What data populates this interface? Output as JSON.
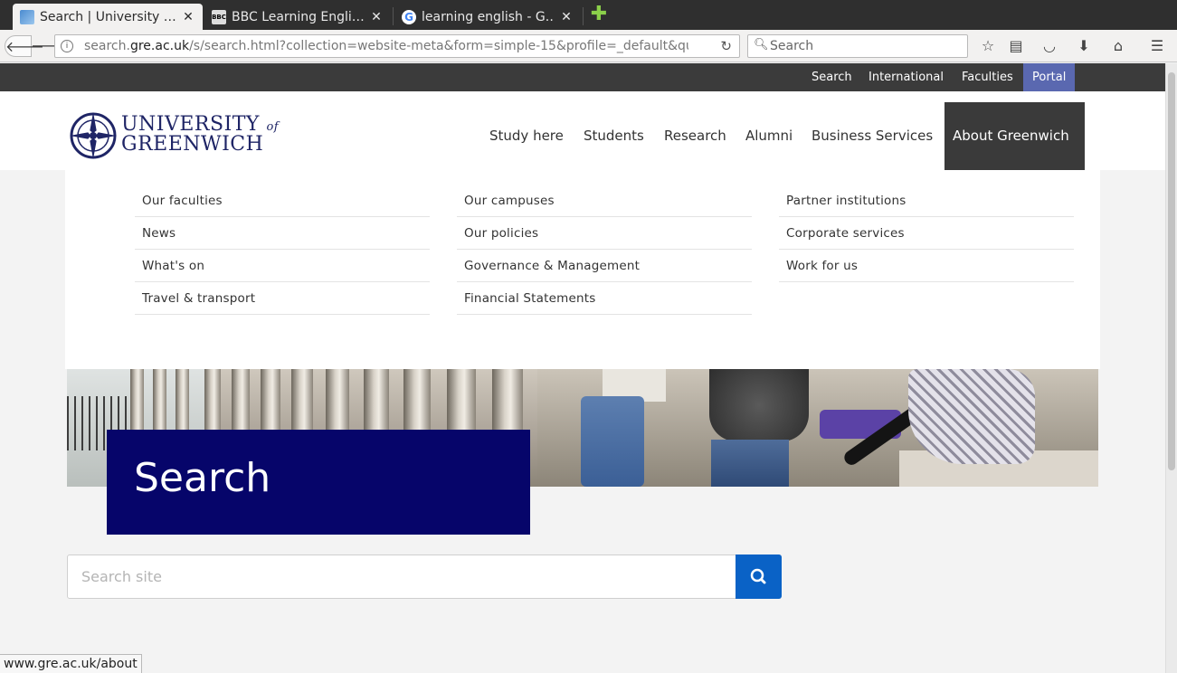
{
  "browser": {
    "tabs": [
      {
        "title": "Search | University …",
        "active": true
      },
      {
        "title": "BBC Learning Engli…",
        "active": false
      },
      {
        "title": "learning english - G…",
        "active": false
      }
    ],
    "url_prefix": "search.",
    "url_domain": "gre.ac.uk",
    "url_rest": "/s/search.html?collection=website-meta&form=simple-15&profile=_default&query",
    "search_placeholder": "Search",
    "status_url": "www.gre.ac.uk/about"
  },
  "utility_nav": {
    "items": [
      "Search",
      "International",
      "Faculties",
      "Portal"
    ]
  },
  "logo": {
    "line1": "UNIVERSITY",
    "of": "of",
    "line2": "GREENWICH",
    "color": "#1f2566"
  },
  "main_nav": {
    "items": [
      "Study here",
      "Students",
      "Research",
      "Alumni",
      "Business Services",
      "About Greenwich"
    ],
    "active": "About Greenwich"
  },
  "mega_menu": {
    "col1": [
      "Our faculties",
      "News",
      "What's on",
      "Travel & transport"
    ],
    "col2": [
      "Our campuses",
      "Our policies",
      "Governance & Management",
      "Financial Statements"
    ],
    "col3": [
      "Partner institutions",
      "Corporate services",
      "Work for us"
    ]
  },
  "hero": {
    "title": "Search",
    "title_bg": "#06056a"
  },
  "site_search": {
    "placeholder": "Search site",
    "button_color": "#0a62c6"
  }
}
